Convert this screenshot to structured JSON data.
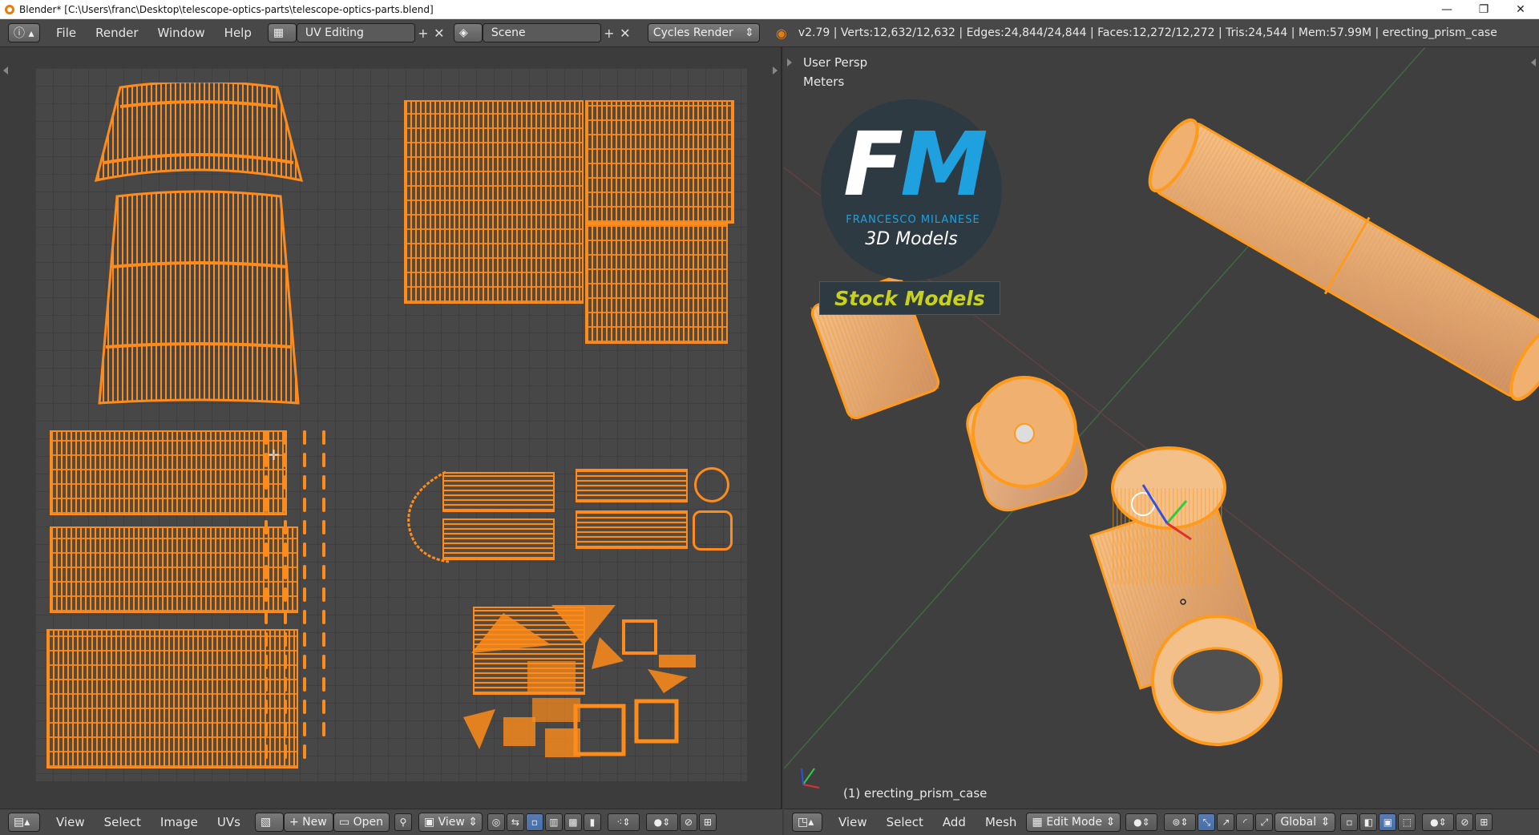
{
  "window": {
    "title": "Blender* [C:\\Users\\franc\\Desktop\\telescope-optics-parts\\telescope-optics-parts.blend]",
    "minimize": "—",
    "maximize": "❐",
    "close": "✕"
  },
  "infobar": {
    "menus": [
      "File",
      "Render",
      "Window",
      "Help"
    ],
    "layout": "UV Editing",
    "scene": "Scene",
    "engine": "Cycles Render",
    "stats": "v2.79 | Verts:12,632/12,632 | Edges:24,844/24,844 | Faces:12,272/12,272 | Tris:24,544 | Mem:57.99M | erecting_prism_case"
  },
  "view3d": {
    "persp": "User Persp",
    "units": "Meters",
    "object_label": "(1) erecting_prism_case"
  },
  "logo": {
    "f": "F",
    "m": "M",
    "name": "FRANCESCO MILANESE",
    "models": "3D Models",
    "stock": "Stock Models"
  },
  "uv_footer": {
    "menus": [
      "View",
      "Select",
      "Image",
      "UVs"
    ],
    "new": "New",
    "open": "Open",
    "view": "View"
  },
  "view3d_footer": {
    "menus": [
      "View",
      "Select",
      "Add",
      "Mesh"
    ],
    "mode": "Edit Mode",
    "orientation": "Global"
  },
  "colors": {
    "accent": "#ff8c1a",
    "background": "#3d3d3d",
    "header": "#484848",
    "logo_blue": "#1fa1e0",
    "stock_yellow": "#c8d21c"
  }
}
